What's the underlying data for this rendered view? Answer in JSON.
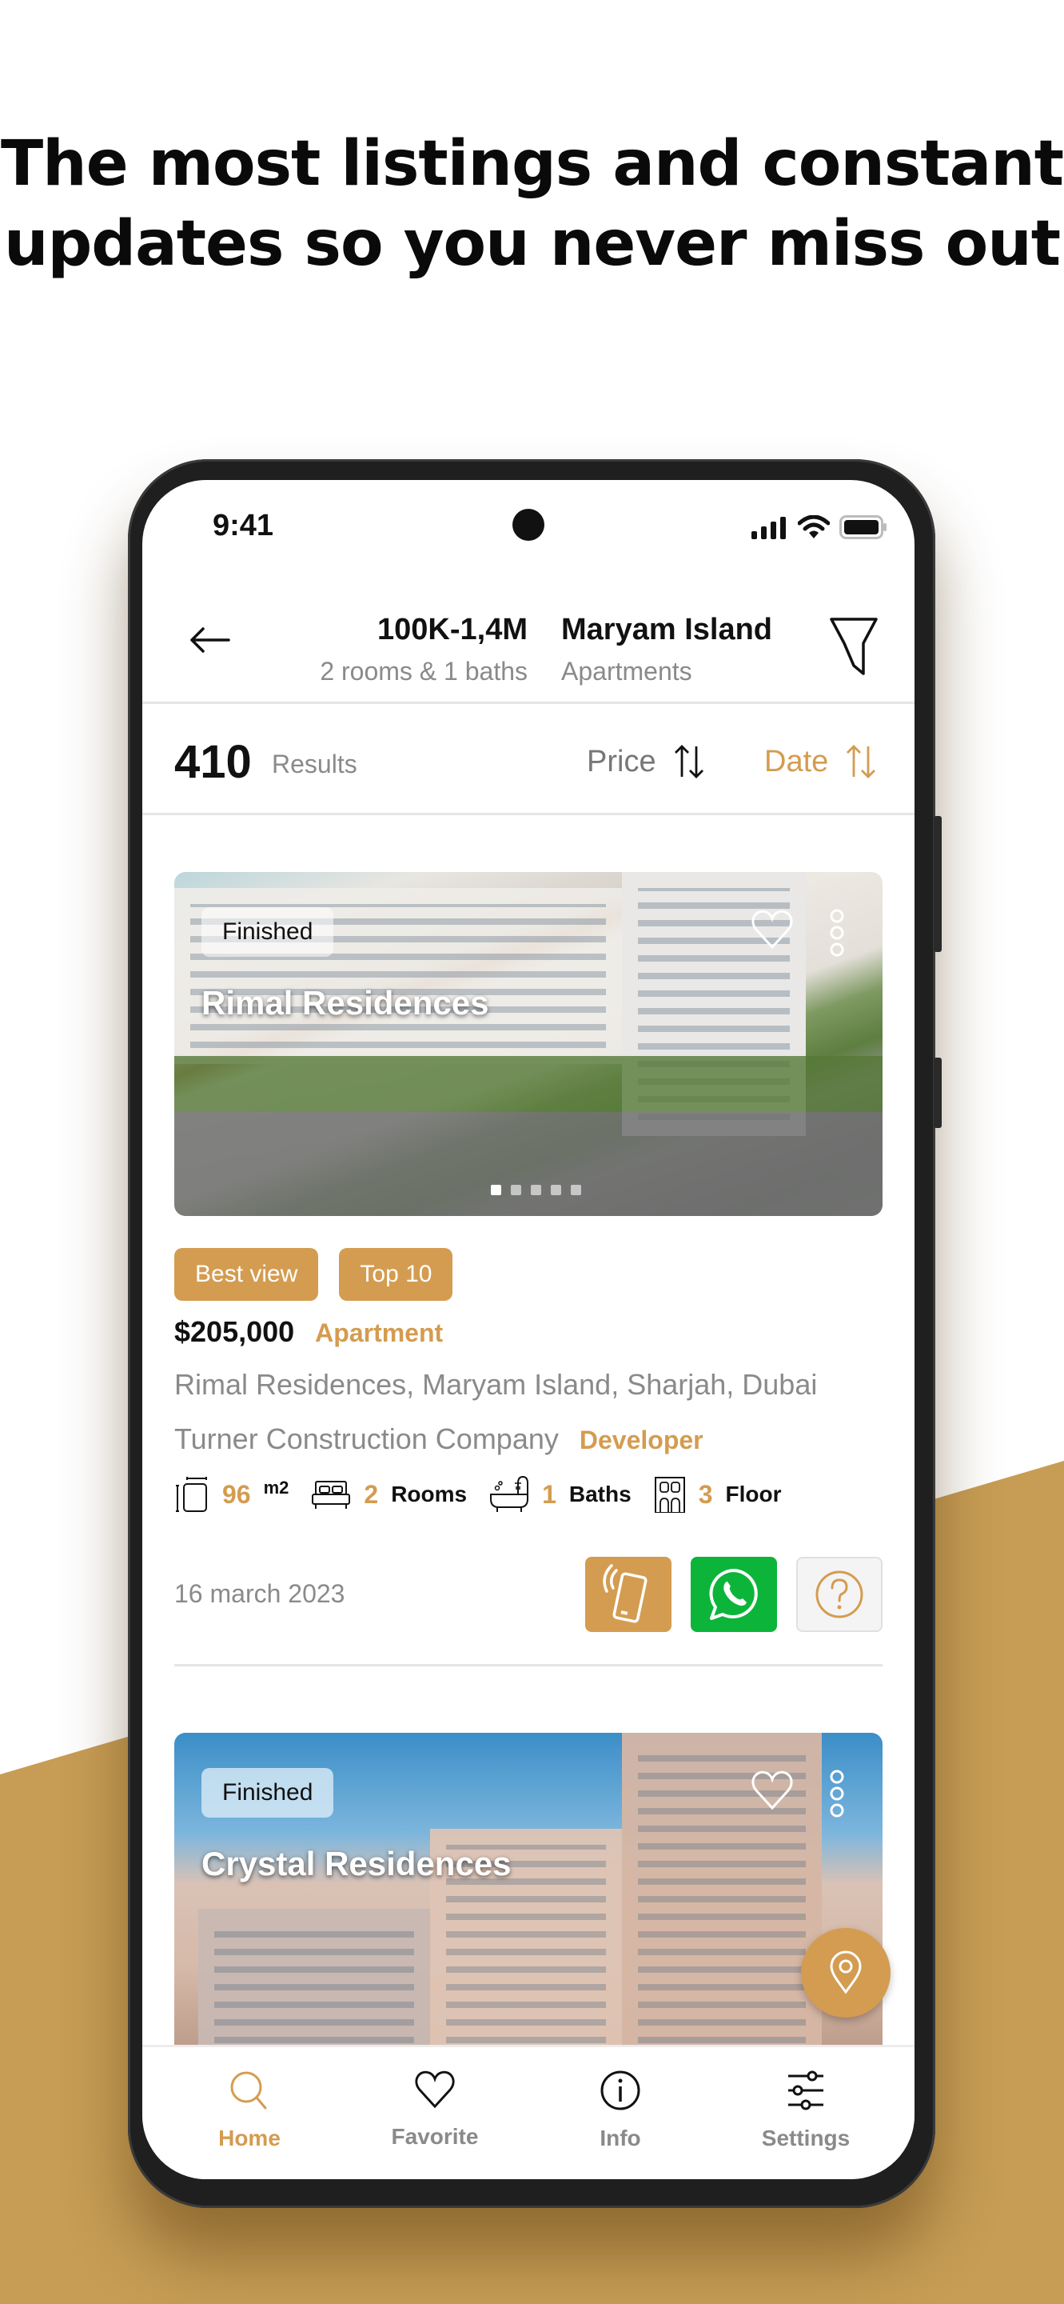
{
  "headline": {
    "line1": "The most listings and constant",
    "line2": "updates so you never miss out"
  },
  "status_bar": {
    "time": "9:41"
  },
  "header": {
    "price_range": "100K-1,4M",
    "rooms_baths": "2 rooms & 1 baths",
    "location": "Maryam Island",
    "property_type": "Apartments"
  },
  "results": {
    "count": "410",
    "label": "Results",
    "sort_price": "Price",
    "sort_date": "Date",
    "active_sort": "Date"
  },
  "listings": [
    {
      "status": "Finished",
      "name": "Rimal Residences",
      "image_count": 5,
      "active_image": 1,
      "tags": [
        "Best view",
        "Top 10"
      ],
      "price": "$205,000",
      "type": "Apartment",
      "address": "Rimal Residences, Maryam Island, Sharjah, Dubai",
      "developer": "Turner Construction Company",
      "developer_label": "Developer",
      "area": "96",
      "area_unit": "m2",
      "rooms": "2",
      "rooms_label": "Rooms",
      "baths": "1",
      "baths_label": "Baths",
      "floor": "3",
      "floor_label": "Floor",
      "date": "16 march 2023"
    },
    {
      "status": "Finished",
      "name": "Crystal Residences"
    }
  ],
  "tabbar": {
    "items": [
      {
        "label": "Home",
        "icon": "search-icon",
        "active": true
      },
      {
        "label": "Favorite",
        "icon": "heart-icon",
        "active": false
      },
      {
        "label": "Info",
        "icon": "info-icon",
        "active": false
      },
      {
        "label": "Settings",
        "icon": "sliders-icon",
        "active": false
      }
    ]
  },
  "colors": {
    "accent": "#d49c50",
    "whatsapp": "#0cb53a",
    "background_gold": "#c79d55",
    "muted_text": "#8a8a8a"
  }
}
